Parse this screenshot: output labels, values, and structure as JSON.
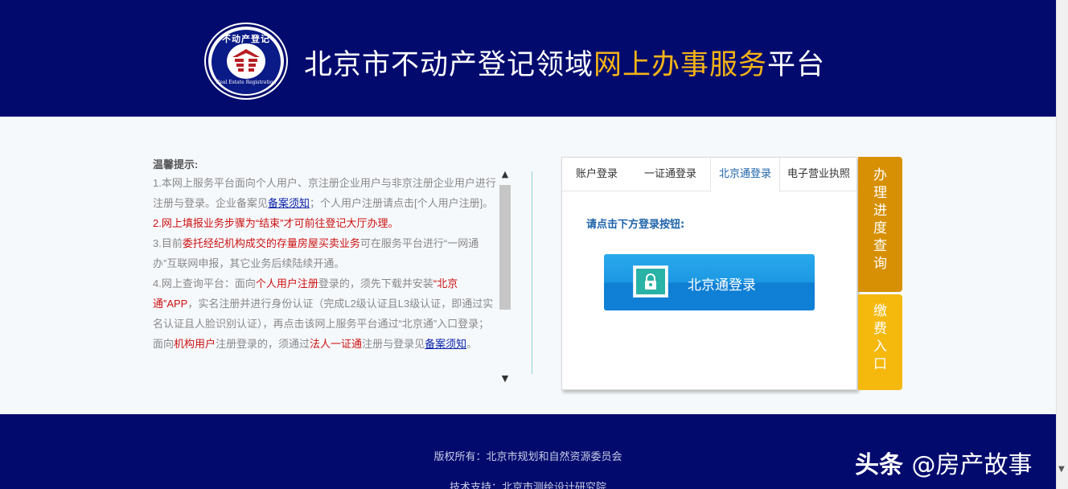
{
  "header": {
    "logo": {
      "top_text": "不动产登记",
      "bottom_text": "Real Estate Registration",
      "icon": "building-emblem-icon"
    },
    "title_part1": "北京市不动产登记领域",
    "title_highlight": "网上办事服务",
    "title_part2": "平台",
    "colors": {
      "background": "#020a6e",
      "highlight": "#f5b316"
    }
  },
  "notice": {
    "heading": "温馨提示:",
    "item1": {
      "text1": "1.本网上服务平台面向个人用户、京注册企业用户与非京注册企业用户进行注册与登录。企业备案见",
      "link": "备案须知",
      "text2": "；个人用户注册请点击[个人用户注册]。"
    },
    "item2": "2.网上填报业务步骤为“结束”才可前往登记大厅办理。",
    "item3": {
      "text1": "3.目前",
      "red": "委托经纪机构成交的存量房屋买卖业务",
      "text2": "可在服务平台进行“一网通办”互联网申报，其它业务后续陆续开通。"
    },
    "item4": {
      "text1": "4.网上查询平台：面向",
      "red1": "个人用户注册",
      "text2": "登录的，须先下载并安装",
      "red2": "“北京通”APP",
      "text3": "，实名注册并进行身份认证（完成L2级认证且L3级认证，即通过实名认证且人脸识别认证），再点击该网上服务平台通过“北京通”入口登录；面向",
      "red3": "机构用户",
      "text4": "注册登录的，须通过",
      "red4": "法人一证通",
      "text5": "注册与登录见",
      "link": "备案须知",
      "text6": "。"
    }
  },
  "login": {
    "tabs": [
      {
        "label": "账户登录",
        "active": false
      },
      {
        "label": "一证通登录",
        "active": false
      },
      {
        "label": "北京通登录",
        "active": true
      },
      {
        "label": "电子营业执照",
        "active": false
      }
    ],
    "prompt": "请点击下方登录按钮:",
    "button_label": "北京通登录",
    "button_icon": "lock-shield-icon"
  },
  "side_buttons": {
    "progress_chars": [
      "办",
      "理",
      "进",
      "度",
      "查",
      "询"
    ],
    "payment_chars": [
      "缴",
      "费",
      "入",
      "口"
    ],
    "colors": {
      "progress": "#d79004",
      "payment": "#f5b80d"
    }
  },
  "footer": {
    "copyright": "版权所有：北京市规划和自然资源委员会",
    "support": "技术支持：北京市测绘设计研究院",
    "watermark_brand": "头条",
    "watermark_handle": "@房产故事"
  }
}
